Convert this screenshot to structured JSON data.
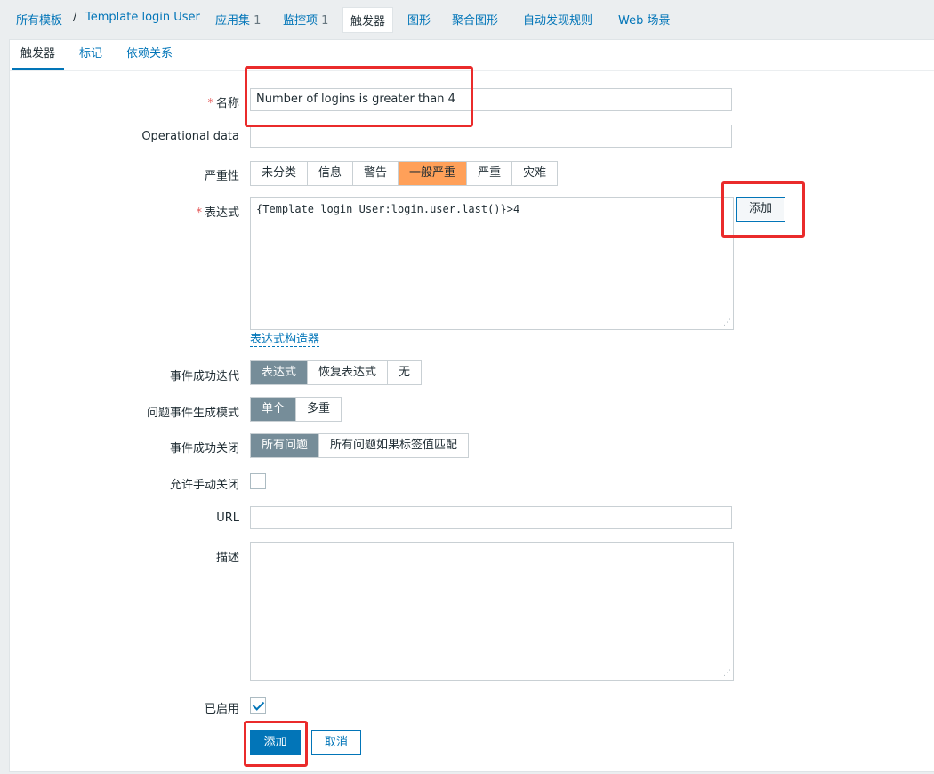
{
  "breadcrumb": {
    "all_templates": "所有模板",
    "separator": "/",
    "template_name": "Template login User",
    "applications": "应用集",
    "applications_count": "1",
    "items": "监控项",
    "items_count": "1",
    "triggers": "触发器",
    "graphs": "图形",
    "screens": "聚合图形",
    "discovery": "自动发现规则",
    "web": "Web 场景"
  },
  "tabs": {
    "trigger": "触发器",
    "tags": "标记",
    "dependencies": "依赖关系"
  },
  "form": {
    "required_mark": "*",
    "name_label": "名称",
    "name_value": "Number of logins is greater than 4",
    "opdata_label": "Operational data",
    "opdata_value": "",
    "severity_label": "严重性",
    "severity_options": [
      "未分类",
      "信息",
      "警告",
      "一般严重",
      "严重",
      "灾难"
    ],
    "severity_selected": "一般严重",
    "expression_label": "表达式",
    "expression_value": "{Template login User:login.user.last()}>4",
    "expression_add_button": "添加",
    "expression_constructor_link": "表达式构造器",
    "ok_event_gen_label": "事件成功迭代",
    "ok_event_gen_options": [
      "表达式",
      "恢复表达式",
      "无"
    ],
    "ok_event_gen_selected": "表达式",
    "problem_mode_label": "问题事件生成模式",
    "problem_mode_options": [
      "单个",
      "多重"
    ],
    "problem_mode_selected": "单个",
    "ok_close_label": "事件成功关闭",
    "ok_close_options": [
      "所有问题",
      "所有问题如果标签值匹配"
    ],
    "ok_close_selected": "所有问题",
    "manual_close_label": "允许手动关闭",
    "manual_close_checked": false,
    "url_label": "URL",
    "url_value": "",
    "description_label": "描述",
    "description_value": "",
    "enabled_label": "已启用",
    "enabled_checked": true,
    "add_button": "添加",
    "cancel_button": "取消"
  },
  "colors": {
    "accent": "#0275b8",
    "severity_average": "#ffa059",
    "selected_segment": "#768d99",
    "highlight_box": "#ea2b2b"
  }
}
